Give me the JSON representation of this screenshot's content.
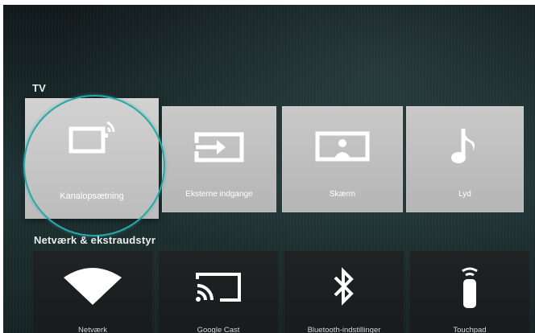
{
  "sections": {
    "tv": {
      "title": "TV",
      "tiles": [
        {
          "label": "Kanalopsætning",
          "icon": "channel-setup-icon"
        },
        {
          "label": "Eksterne indgange",
          "icon": "external-input-icon"
        },
        {
          "label": "Skærm",
          "icon": "display-icon"
        },
        {
          "label": "Lyd",
          "icon": "music-note-icon"
        }
      ]
    },
    "network": {
      "title": "Netværk & ekstraudstyr",
      "tiles": [
        {
          "label": "Netværk",
          "icon": "wifi-icon"
        },
        {
          "label": "Google Cast",
          "icon": "cast-icon"
        },
        {
          "label": "Bluetooth-indstillinger",
          "icon": "bluetooth-icon"
        },
        {
          "label": "Touchpad",
          "icon": "remote-control-icon"
        }
      ]
    }
  },
  "colors": {
    "focus_ring": "#2aa8a8",
    "tile_light": "#bdbdbd",
    "tile_dark": "#1c2020",
    "background": "#1a2a2b"
  }
}
